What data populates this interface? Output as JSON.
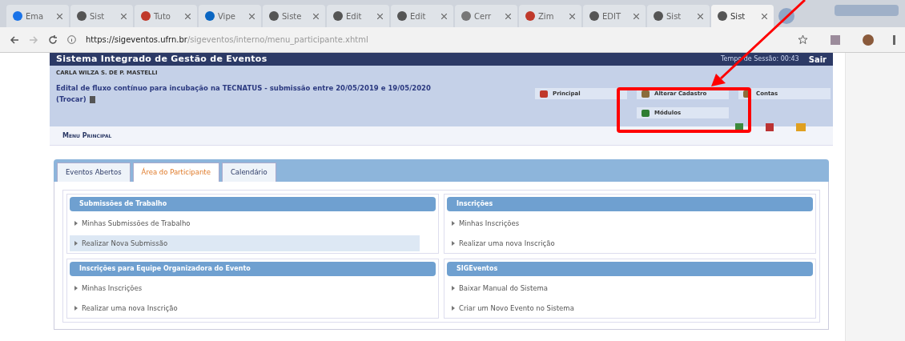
{
  "browser": {
    "tabs": [
      {
        "label": "Ema",
        "selected": false
      },
      {
        "label": "Sist",
        "selected": false
      },
      {
        "label": "Tuto",
        "selected": false
      },
      {
        "label": "Vipe",
        "selected": false
      },
      {
        "label": "Siste",
        "selected": false
      },
      {
        "label": "Edit",
        "selected": false
      },
      {
        "label": "Edit",
        "selected": false
      },
      {
        "label": "Cerr",
        "selected": false
      },
      {
        "label": "Zim",
        "selected": false
      },
      {
        "label": "EDIT",
        "selected": false
      },
      {
        "label": "Sist",
        "selected": false
      },
      {
        "label": "Sist",
        "selected": true
      }
    ],
    "url": {
      "host": "https://sigeventos.ufrn.br",
      "path": "/sigeventos/interno/menu_participante.xhtml"
    }
  },
  "header": {
    "title": "Sistema Integrado de Gestão de Eventos",
    "session": "Tempo de Sessão: 00:43",
    "logout": "Sair"
  },
  "user": {
    "name": "CARLA WILZA S. DE P. MASTELLI",
    "event": "Edital de fluxo contínuo para incubação na TECNATUS - submissão entre 20/05/2019 e 19/05/2020",
    "change": "(Trocar)"
  },
  "shortcuts": [
    {
      "label": "Principal"
    },
    {
      "label": "Alterar Cadastro"
    },
    {
      "label": "Contas"
    },
    {
      "label": "Módulos"
    }
  ],
  "menu_title": "Menu Principal",
  "page_tabs": [
    {
      "label": "Eventos Abertos",
      "selected": false
    },
    {
      "label": "Área do Participante",
      "selected": true
    },
    {
      "label": "Calendário",
      "selected": false
    }
  ],
  "sections": [
    {
      "title": "Submissões de Trabalho",
      "items": [
        {
          "label": "Minhas Submissões de Trabalho",
          "selected": false
        },
        {
          "label": "Realizar Nova Submissão",
          "selected": true
        }
      ]
    },
    {
      "title": "Inscrições",
      "items": [
        {
          "label": "Minhas Inscrições",
          "selected": false
        },
        {
          "label": "Realizar uma nova Inscrição",
          "selected": false
        }
      ]
    },
    {
      "title": "Inscrições para Equipe Organizadora do Evento",
      "items": [
        {
          "label": "Minhas Inscrições",
          "selected": false
        },
        {
          "label": "Realizar uma nova Inscrição",
          "selected": false
        }
      ]
    },
    {
      "title": "SIGEventos",
      "items": [
        {
          "label": "Baixar Manual do Sistema",
          "selected": false
        },
        {
          "label": "Criar um Novo Evento no Sistema",
          "selected": false
        }
      ]
    }
  ]
}
